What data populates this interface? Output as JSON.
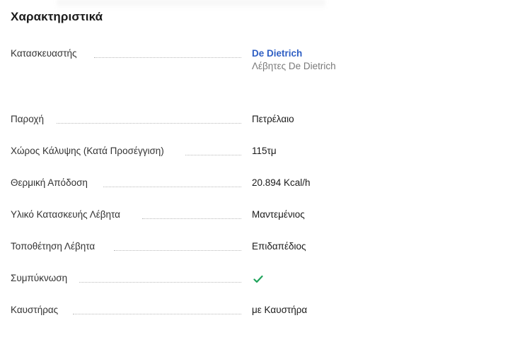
{
  "section": {
    "title": "Χαρακτηριστικά"
  },
  "specs": {
    "manufacturer": {
      "label": "Κατασκευαστής",
      "value": "De Dietrich",
      "sub": "Λέβητες De Dietrich"
    },
    "supply": {
      "label": "Παροχή",
      "value": "Πετρέλαιο"
    },
    "coverage": {
      "label": "Χώρος Κάλυψης (Κατά Προσέγγιση)",
      "value": "115τμ"
    },
    "thermal_output": {
      "label": "Θερμική Απόδοση",
      "value": "20.894 Kcal/h"
    },
    "material": {
      "label": "Υλικό Κατασκευής Λέβητα",
      "value": "Μαντεμένιος"
    },
    "placement": {
      "label": "Τοποθέτηση Λέβητα",
      "value": "Επιδαπέδιος"
    },
    "condensing": {
      "label": "Συμπύκνωση",
      "value_icon": "check-icon",
      "value_color": "#1fa35b"
    },
    "burner": {
      "label": "Καυστήρας",
      "value": "με Καυστήρα"
    }
  }
}
